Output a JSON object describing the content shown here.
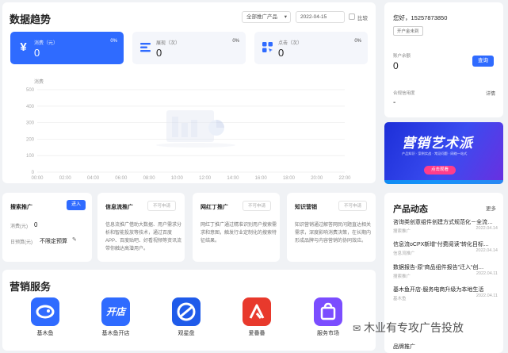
{
  "trend": {
    "title": "数据趋势",
    "product_select": "全部推广产品",
    "date_select": "2022-04-15",
    "compare_label": "比较",
    "metrics": [
      {
        "label": "消费（元）",
        "value": "0",
        "pct": "0%"
      },
      {
        "label": "展现（次）",
        "value": "0",
        "pct": "0%"
      },
      {
        "label": "点击（次）",
        "value": "0",
        "pct": "0%"
      }
    ],
    "chart_data": {
      "type": "line",
      "ylabel": "消费",
      "ylim": [
        0,
        500
      ],
      "yticks": [
        "500",
        "400",
        "300",
        "200",
        "100",
        "0"
      ],
      "x": [
        "00:00",
        "02:00",
        "04:00",
        "06:00",
        "08:00",
        "10:00",
        "12:00",
        "14:00",
        "16:00",
        "18:00",
        "20:00",
        "22:00"
      ],
      "series": []
    }
  },
  "account": {
    "greeting": "您好，15257873850",
    "badge": "开户金未到",
    "balance_label": "账户余额",
    "balance_value": "0",
    "recharge_button": "查询",
    "credit_label": "合规信用度",
    "credit_value": "-",
    "credit_link": "详情"
  },
  "banner": {
    "title": "营销艺术派",
    "subtitle": "产品知识 · 案例实战 · 常见问题 · 网络一站式",
    "cta": "点击观看"
  },
  "promos": [
    {
      "title": "搜索推广",
      "button": "进入",
      "row1_label": "消费(元)",
      "row1_value": "0",
      "row2_label": "日预算(元)",
      "row2_value": "不限定预算"
    },
    {
      "title": "信息流推广",
      "tag": "不可申请",
      "desc": "信息流推广借助大数据、用户需求分析和智能投放等技术，通过百度APP、百度贴吧、好看视频等资讯流带你触达高潜用户。"
    },
    {
      "title": "网红丁推广",
      "tag": "不可申请",
      "desc": "网红丁推广通过精准识别用户搜索需求和意图，触发行业定制化的搜索特征结果。"
    },
    {
      "title": "知识营销",
      "tag": "不可申请",
      "desc": "知识营销通过解答网民问题直达相关需求，深度影响消费决策，在长期内形成品牌与内容营销的协同效应。"
    }
  ],
  "services": {
    "title": "营销服务",
    "items": [
      {
        "label": "基木鱼",
        "icon": "jimuyu-icon",
        "color": "#2f6bff"
      },
      {
        "label": "基木鱼开店",
        "icon": "kaidian-icon",
        "color": "#2f6bff"
      },
      {
        "label": "观星盘",
        "icon": "guanxingpan-icon",
        "color": "#1f5bea"
      },
      {
        "label": "爱番番",
        "icon": "aifanfan-icon",
        "color": "#e8392c"
      },
      {
        "label": "服务市场",
        "icon": "market-icon",
        "color": "#7b4dff"
      }
    ]
  },
  "news": {
    "title": "产品动态",
    "more": "更多",
    "items": [
      {
        "title": "咨询类创意组件创建方式规范化－全流…",
        "meta": "搜索推广",
        "date": "2022.04.14"
      },
      {
        "title": "信息流oCPX新增“付费阅读”转化目标…",
        "meta": "信息流推广",
        "date": "2022.04.14"
      },
      {
        "title": "数据报告-原“商品组件报告”迁入“创…",
        "meta": "搜索推广",
        "date": "2022.04.11"
      },
      {
        "title": "基木鱼开店-服务电商升级为本地生活",
        "meta": "基木鱼",
        "date": "2022.04.11"
      },
      {
        "title": "品牌推广",
        "meta": "",
        "date": ""
      }
    ]
  },
  "watermark": "木业有专攻广告投放"
}
